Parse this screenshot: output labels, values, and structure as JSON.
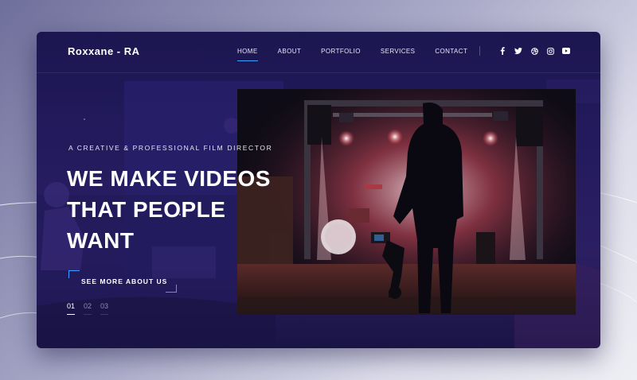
{
  "brand": {
    "logo_text": "Roxxane - RA"
  },
  "nav": {
    "items": [
      {
        "label": "HOME",
        "active": true
      },
      {
        "label": "ABOUT",
        "active": false
      },
      {
        "label": "PORTFOLIO",
        "active": false
      },
      {
        "label": "SERVICES",
        "active": false
      },
      {
        "label": "CONTACT",
        "active": false
      }
    ],
    "social_icons": [
      "facebook-icon",
      "twitter-icon",
      "dribbble-icon",
      "instagram-icon",
      "youtube-icon"
    ]
  },
  "hero": {
    "tagline": "A CREATIVE & PROFESSIONAL FILM DIRECTOR",
    "headline_lines": [
      "WE MAKE VIDEOS",
      "THAT PEOPLE",
      "WANT"
    ],
    "cta_label": "SEE MORE ABOUT US",
    "pager": [
      {
        "label": "01",
        "active": true
      },
      {
        "label": "02",
        "active": false
      },
      {
        "label": "03",
        "active": false
      }
    ]
  },
  "colors": {
    "accent": "#3aa0ff",
    "frame_bg": "#241b5e",
    "text": "#ffffff"
  }
}
